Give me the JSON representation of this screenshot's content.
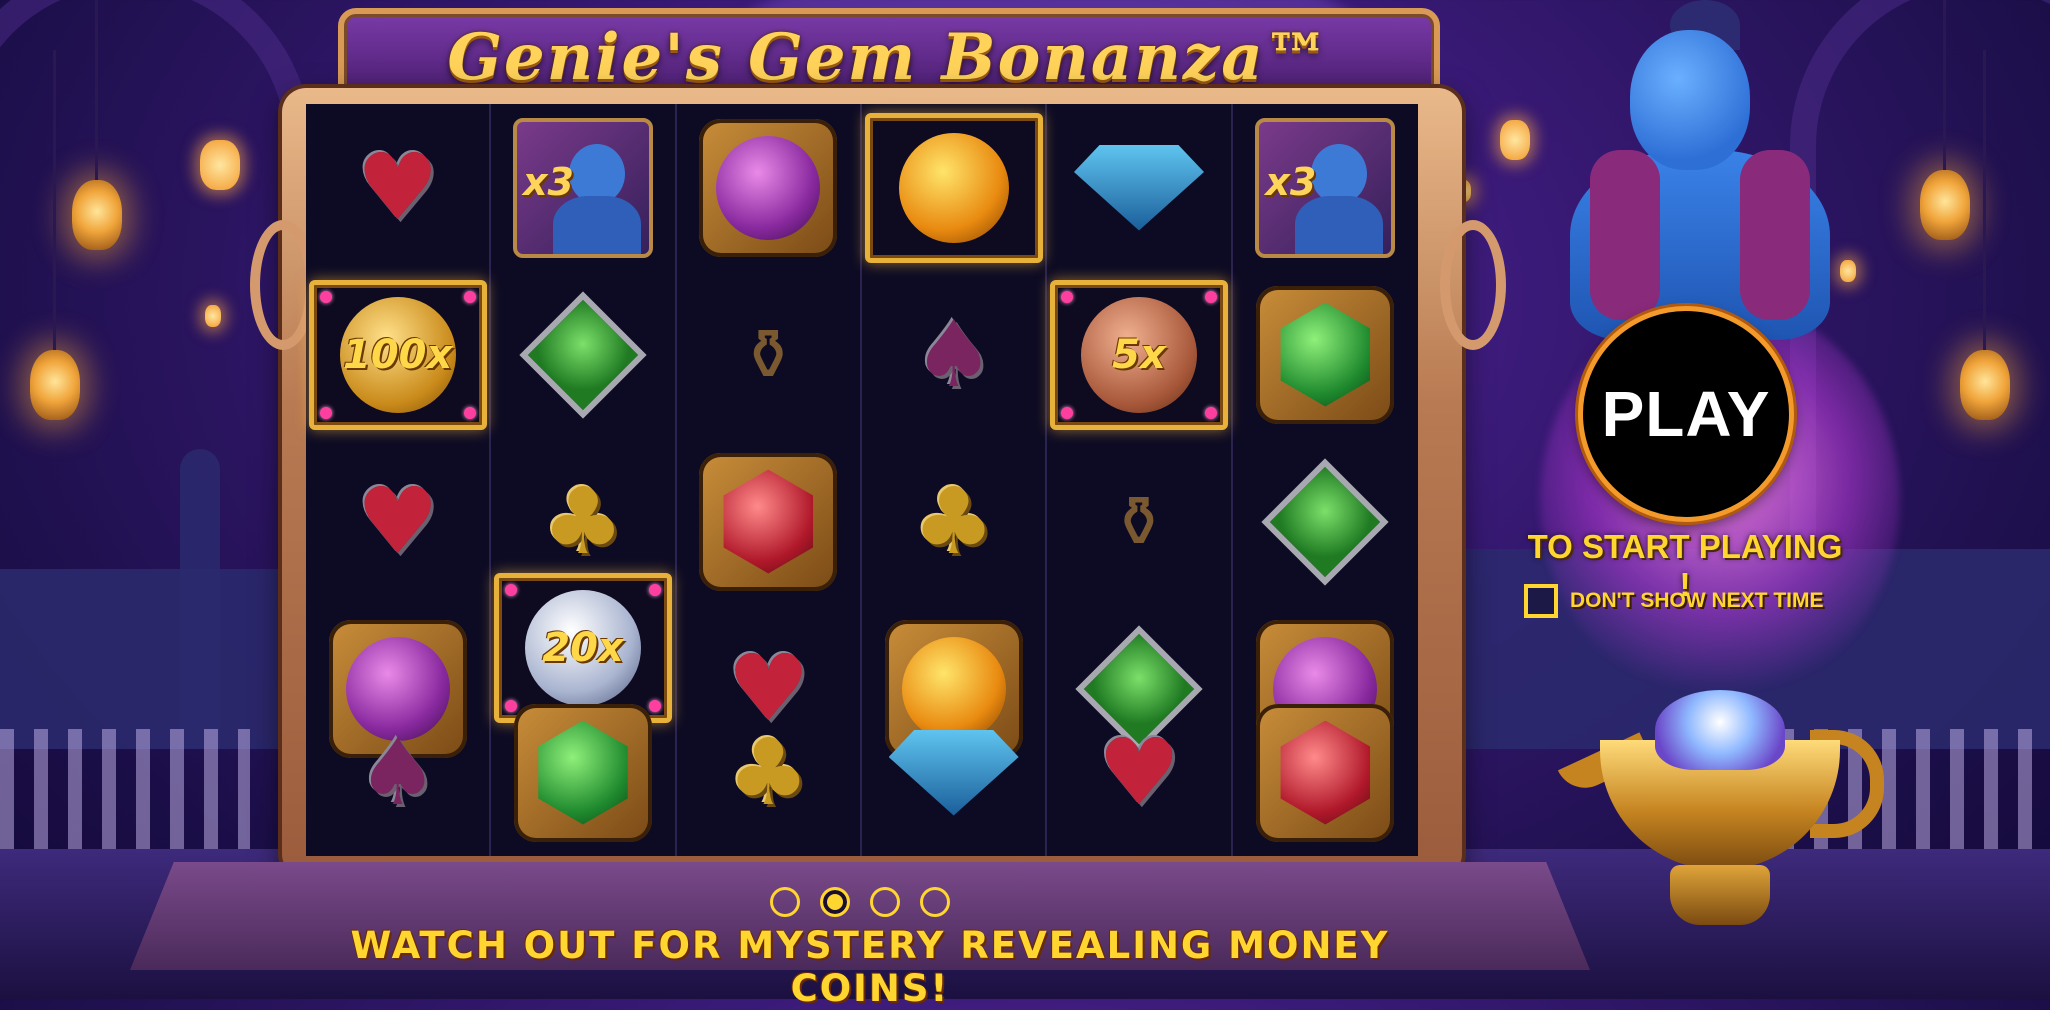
{
  "game": {
    "title": "Genie's Gem Bonanza™"
  },
  "reels": {
    "columns": [
      [
        "red-heart",
        "gold-coin-100x",
        "red-heart",
        "purple-round-gem",
        "purple-spade"
      ],
      [
        "genie-x3",
        "green-diamond",
        "gold-club",
        "silver-coin-20x",
        "green-hex-gem"
      ],
      [
        "purple-round-gem",
        "magic-lamp-faded",
        "red-hex-gem",
        "red-heart",
        "gold-club"
      ],
      [
        "yellow-round-gem-framed",
        "purple-spade",
        "gold-club",
        "yellow-round-gem",
        "blue-diamond"
      ],
      [
        "blue-diamond",
        "bronze-coin-5x",
        "magic-lamp-faded",
        "green-diamond",
        "red-heart"
      ],
      [
        "genie-x3",
        "green-hex-gem",
        "green-diamond",
        "purple-round-gem",
        "red-hex-gem"
      ]
    ],
    "multipliers": {
      "genie": "x3",
      "gold_coin": "100x",
      "bronze_coin": "5x",
      "silver_coin": "20x"
    }
  },
  "intro": {
    "play_label": "PLAY",
    "start_text": "TO START PLAYING !",
    "dont_show_label": "DON'T SHOW NEXT TIME",
    "caption": "WATCH OUT FOR MYSTERY REVEALING MONEY COINS!",
    "page_count": 4,
    "current_page": 2
  },
  "colors": {
    "accent_gold": "#ffd530",
    "play_ring": "#f39a2a",
    "background": "#3a1a78"
  }
}
